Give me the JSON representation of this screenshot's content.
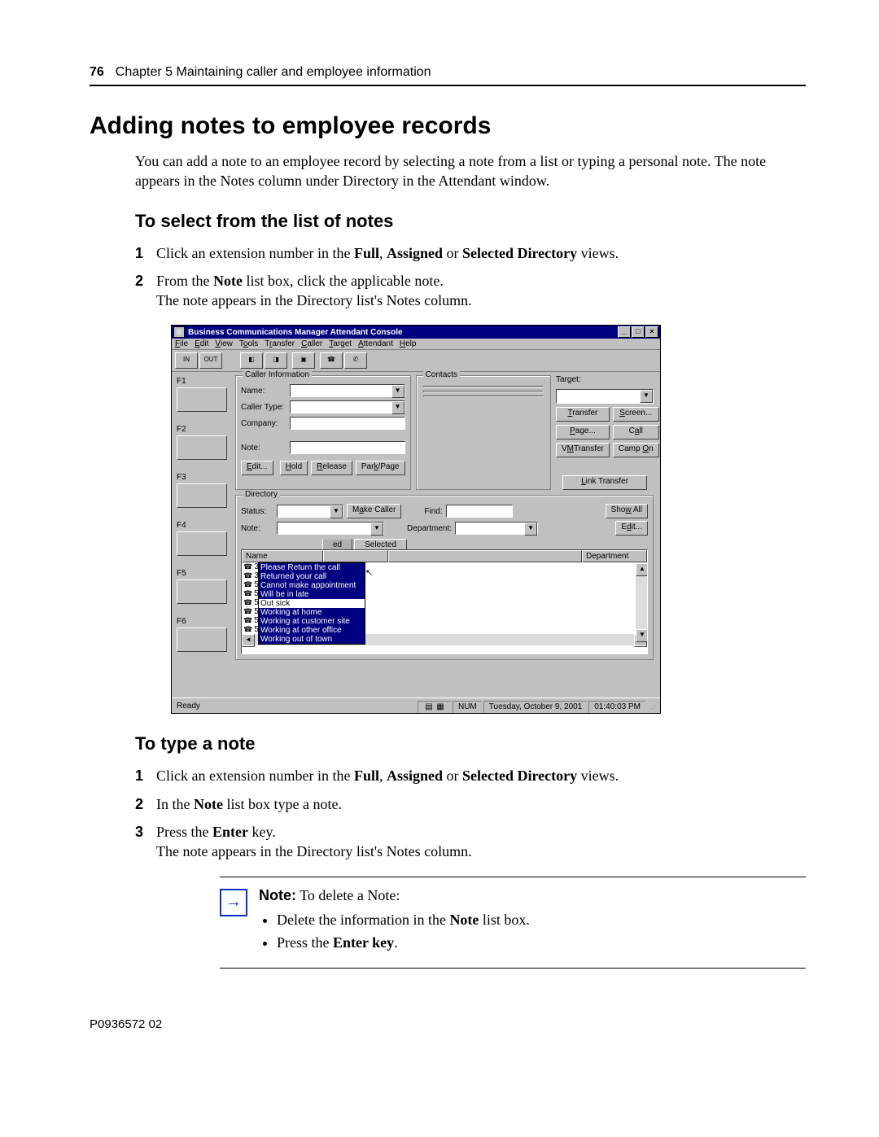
{
  "header": {
    "page_number": "76",
    "chapter_ref": "Chapter 5  Maintaining caller and employee information"
  },
  "h1": "Adding notes to employee records",
  "intro": "You can add a note to an employee record by selecting a note from a list or typing a personal note. The note appears in the Notes column under Directory in the Attendant window.",
  "h2a": "To select from the list of notes",
  "steps_a": {
    "s1_pre": "Click an extension number in the ",
    "s1_b1": "Full",
    "s1_mid1": ", ",
    "s1_b2": "Assigned",
    "s1_mid2": " or ",
    "s1_b3": "Selected Directory",
    "s1_post": " views.",
    "s2_pre": "From the ",
    "s2_b1": "Note",
    "s2_mid": " list box, click the applicable note.",
    "s2_line2": "The note appears in the Directory list's Notes column."
  },
  "window": {
    "title": "Business Communications Manager Attendant Console",
    "winbtns": {
      "min": "_",
      "max": "□",
      "close": "×"
    },
    "menus": {
      "file": "File",
      "edit": "Edit",
      "view": "View",
      "tools": "Tools",
      "transfer": "Transfer",
      "caller": "Caller",
      "target": "Target",
      "attendant": "Attendant",
      "help": "Help",
      "file_u": "F",
      "edit_u": "E",
      "view_u": "V",
      "tools_u": "o",
      "transfer_u": "r",
      "caller_u": "C",
      "target_u": "T",
      "attendant_u": "A",
      "help_u": "H"
    },
    "toolbar": {
      "in": "IN",
      "out": "OUT"
    },
    "loops": {
      "f1": "F1",
      "f2": "F2",
      "f3": "F3",
      "f4": "F4",
      "f5": "F5",
      "f6": "F6"
    },
    "caller_info": {
      "legend": "Caller Information",
      "name": "Name:",
      "caller_type": "Caller Type:",
      "company": "Company:",
      "note": "Note:",
      "edit": "Edit...",
      "hold": "Hold",
      "release": "Release",
      "parkpage": "Park/Page"
    },
    "contacts": {
      "legend": "Contacts"
    },
    "target": {
      "label": "Target:",
      "transfer": "Transfer",
      "screen": "Screen...",
      "page": "Page...",
      "call": "Call",
      "vmtransfer": "VMTransfer",
      "campon": "Camp On",
      "linktransfer": "Link Transfer"
    },
    "directory": {
      "legend": "Directory",
      "status": "Status:",
      "make_caller": "Make Caller",
      "find": "Find:",
      "show_all": "Show All",
      "note": "Note:",
      "department": "Department:",
      "edit": "Edit...",
      "tabs": {
        "assigned": "ed",
        "selected": "Selected"
      },
      "headers": {
        "name": "Name",
        "ext": "",
        "notes": "",
        "department": "Department"
      },
      "rows": [
        {
          "name": "3",
          "ext": ""
        },
        {
          "name": "3",
          "ext": ""
        },
        {
          "name": "5",
          "ext": ""
        },
        {
          "name": "5",
          "ext": ""
        },
        {
          "name": "567",
          "ext": "567"
        },
        {
          "name": "568",
          "ext": "568"
        },
        {
          "name": "569",
          "ext": "569"
        },
        {
          "name": "570",
          "ext": "570"
        }
      ],
      "note_options": [
        "Please Return the call",
        "Returned your call",
        "Cannot make appointment",
        "Will be in late",
        "Out sick",
        "Working at home",
        "Working at customer site",
        "Working at other office",
        "Working out of town"
      ]
    },
    "statusbar": {
      "ready": "Ready",
      "num": "NUM",
      "date": "Tuesday, October 9, 2001",
      "time": "01:40:03 PM"
    }
  },
  "h2b": "To type a note",
  "steps_b": {
    "s1_pre": "Click an extension number in the ",
    "s1_b1": "Full",
    "s1_mid1": ", ",
    "s1_b2": "Assigned",
    "s1_mid2": " or ",
    "s1_b3": "Selected Directory",
    "s1_post": " views.",
    "s2_pre": "In the ",
    "s2_b1": "Note",
    "s2_post": " list box type a note.",
    "s3_pre": "Press the ",
    "s3_b1": "Enter",
    "s3_post": " key.",
    "s3_line2": "The note appears in the Directory list's Notes column."
  },
  "note_box": {
    "lead_bold": "Note:",
    "lead_rest": " To delete a Note:",
    "bullet1_pre": "Delete the information in the ",
    "bullet1_b": "Note",
    "bullet1_post": " list box.",
    "bullet2_pre": "Press the ",
    "bullet2_b": "Enter key",
    "bullet2_post": "."
  },
  "footer": "P0936572 02"
}
